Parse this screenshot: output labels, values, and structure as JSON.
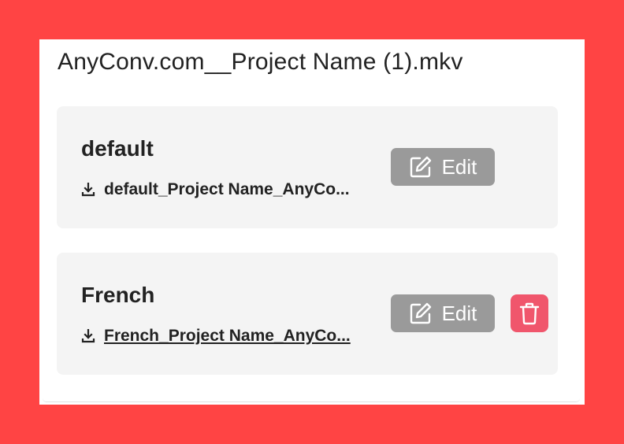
{
  "file": {
    "title": "AnyConv.com__Project Name (1).mkv"
  },
  "tracks": [
    {
      "language": "default",
      "download_name": "default_Project Name_AnyCo...",
      "edit_label": "Edit"
    },
    {
      "language": "French",
      "download_name": "French_Project Name_AnyCo...",
      "edit_label": "Edit"
    }
  ],
  "icons": {
    "download": "download-icon",
    "edit": "edit-icon",
    "delete": "trash-icon"
  },
  "colors": {
    "background": "#ff4444",
    "card": "#f4f4f4",
    "edit_button": "#9a9a9a",
    "delete_button": "#f0566c"
  }
}
